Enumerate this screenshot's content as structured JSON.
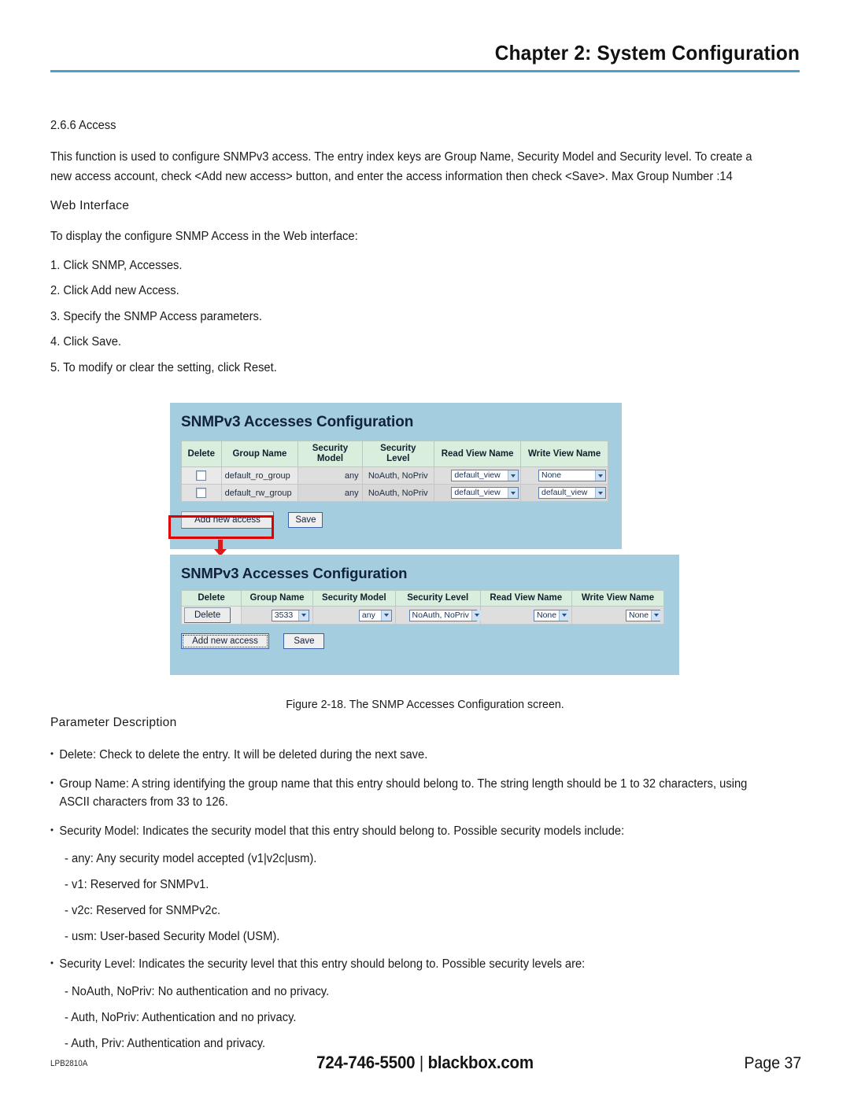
{
  "header": {
    "chapter_title": "Chapter 2: System Configuration",
    "rule_color": "#4d9fd0"
  },
  "body": {
    "section_number_title": "2.6.6 Access",
    "intro_paragraph": "This function is used to configure SNMPv3 access. The entry index keys are Group Name, Security Model and Security level. To create a new access account, check <Add new access> button, and enter the access information then check <Save>. Max Group Number :14",
    "web_interface_heading": "Web Interface",
    "display_line": "To display the configure SNMP Access in the Web interface:",
    "steps": [
      "1. Click SNMP, Accesses.",
      "2. Click Add new Access.",
      "3. Specify the SNMP Access parameters.",
      "4. Click Save.",
      "5. To modify or clear the setting, click Reset."
    ]
  },
  "figure": {
    "caption": "Figure 2-18. The SNMP Accesses Configuration screen.",
    "panel_bg": "#a4cddf",
    "highlight_color": "#e00000",
    "panel1": {
      "title": "SNMPv3 Accesses Configuration",
      "columns": [
        "Delete",
        "Group Name",
        "Security Model",
        "Security Level",
        "Read View Name",
        "Write View Name"
      ],
      "column_lines": [
        [
          "Delete"
        ],
        [
          "Group Name"
        ],
        [
          "Security",
          "Model"
        ],
        [
          "Security",
          "Level"
        ],
        [
          "Read View Name"
        ],
        [
          "Write View Name"
        ]
      ],
      "rows": [
        {
          "delete_checked": false,
          "group_name": "default_ro_group",
          "security_model": "any",
          "security_level": "NoAuth, NoPriv",
          "read_view_name": "default_view",
          "write_view_name": "None"
        },
        {
          "delete_checked": false,
          "group_name": "default_rw_group",
          "security_model": "any",
          "security_level": "NoAuth, NoPriv",
          "read_view_name": "default_view",
          "write_view_name": "default_view"
        }
      ],
      "add_button": "Add new access",
      "save_button": "Save"
    },
    "panel2": {
      "title": "SNMPv3 Accesses Configuration",
      "columns": [
        "Delete",
        "Group Name",
        "Security Model",
        "Security Level",
        "Read View Name",
        "Write View Name"
      ],
      "row": {
        "delete_button": "Delete",
        "group_name": "3533",
        "security_model": "any",
        "security_level": "NoAuth, NoPriv",
        "read_view_name": "None",
        "write_view_name": "None"
      },
      "add_button": "Add new access",
      "save_button": "Save"
    }
  },
  "parameters": {
    "heading": "Parameter Description",
    "items": [
      "Delete: Check to delete the entry. It will be deleted during the next save.",
      "Group Name: A string identifying the group name that this entry should belong to. The string length should be 1 to 32 characters, using ASCII characters from 33 to 126.",
      "Security Model: Indicates the security model that this entry should belong to. Possible security models include:",
      "Security Level: Indicates the security level that this entry should belong to. Possible security levels are:"
    ],
    "security_model_subitems": [
      "- any: Any security model accepted (v1|v2c|usm).",
      "- v1: Reserved for SNMPv1.",
      "- v2c: Reserved for SNMPv2c.",
      "- usm: User-based Security Model (USM)."
    ],
    "security_level_subitems": [
      "- NoAuth, NoPriv: No authentication and no privacy.",
      "- Auth, NoPriv: Authentication and no privacy.",
      "- Auth, Priv: Authentication and privacy."
    ]
  },
  "footer": {
    "product_code": "LPB2810A",
    "phone": "724-746-5500",
    "separator": "|",
    "website": "blackbox.com",
    "page_label": "Page 37"
  }
}
